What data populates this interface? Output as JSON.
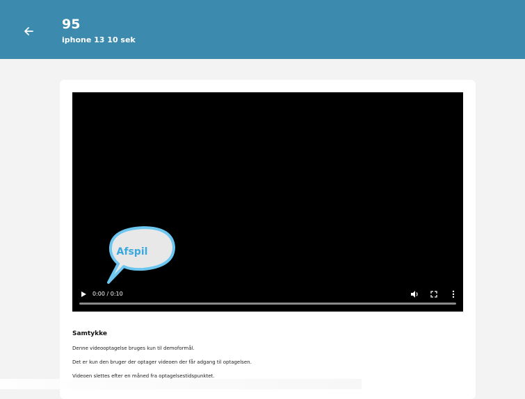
{
  "header": {
    "title": "95",
    "subtitle": "iphone 13 10 sek",
    "back_icon": "arrow-left-icon",
    "background": "#3c8aad"
  },
  "video": {
    "bubble_label": "Afspil",
    "time": "0:00 / 0:10",
    "progress": 0,
    "icons": [
      "play-icon",
      "volume-icon",
      "fullscreen-icon",
      "more-vert-icon"
    ]
  },
  "consent": {
    "title": "Samtykke",
    "lines": [
      "Denne videooptagelse bruges kun til demoformål.",
      "Det er kun den bruger der optager videoen der får adgang til optagelsen.",
      "Videoen slettes efter en måned fra optagelsestidspunktet."
    ]
  }
}
